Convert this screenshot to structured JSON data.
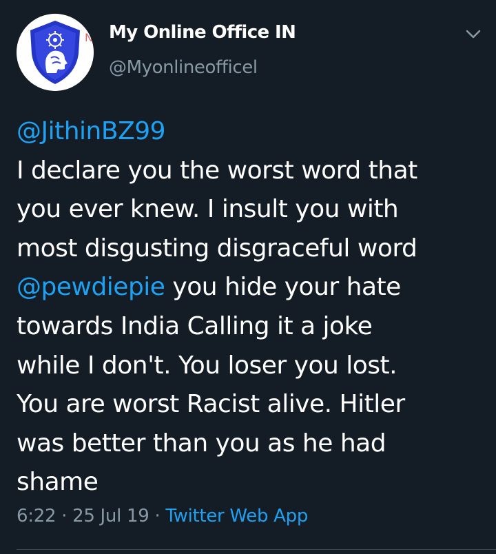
{
  "tweet": {
    "author": {
      "name": "My Online Office IN",
      "handle": "@Myonlineofficel",
      "avatar_icon": "blue-shield-brain-logo-icon"
    },
    "menu_icon": "chevron-down-icon",
    "text_lines": [
      [
        {
          "type": "mention",
          "text": "@JithinBZ99"
        }
      ],
      [
        {
          "type": "text",
          "text": "I declare you the worst word that"
        }
      ],
      [
        {
          "type": "text",
          "text": "you ever knew. I insult you with"
        }
      ],
      [
        {
          "type": "text",
          "text": "most disgusting disgraceful word"
        }
      ],
      [
        {
          "type": "mention",
          "text": "@pewdiepie"
        },
        {
          "type": "text",
          "text": " you hide your hate"
        }
      ],
      [
        {
          "type": "text",
          "text": "towards India Calling it a joke"
        }
      ],
      [
        {
          "type": "text",
          "text": "while I don't. You loser you lost."
        }
      ],
      [
        {
          "type": "text",
          "text": "You are worst Racist alive. Hitler"
        }
      ],
      [
        {
          "type": "text",
          "text": "was better than you as he had"
        }
      ],
      [
        {
          "type": "text",
          "text": "shame"
        }
      ]
    ],
    "time": "6:22",
    "separator": "·",
    "date": "25 Jul 19",
    "source": "Twitter Web App"
  },
  "colors": {
    "background": "#141d26",
    "text": "#ffffff",
    "secondary_text": "#8899a6",
    "link": "#1da1f2",
    "divider": "#38444d",
    "avatar_shield": "#2f3fd0"
  }
}
